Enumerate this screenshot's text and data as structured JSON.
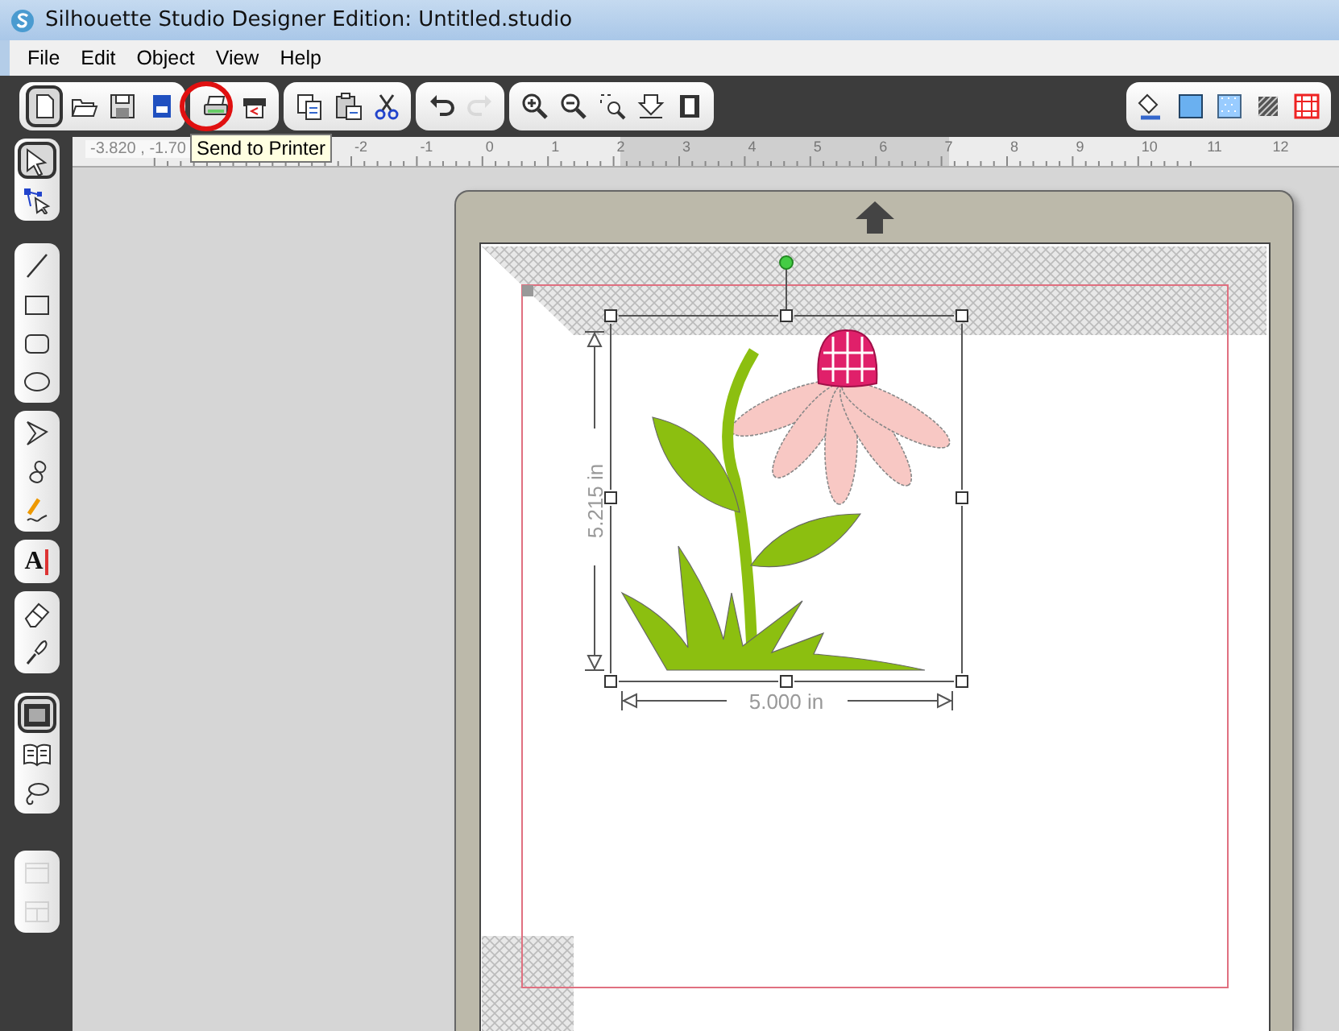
{
  "window": {
    "title": "Silhouette Studio Designer Edition: Untitled.studio"
  },
  "menu": [
    "File",
    "Edit",
    "Object",
    "View",
    "Help"
  ],
  "toolbar": {
    "groups": [
      [
        {
          "kind": "new",
          "selected": true,
          "disabled": false
        },
        {
          "kind": "open",
          "selected": false,
          "disabled": false
        },
        {
          "kind": "save",
          "selected": false,
          "disabled": false
        },
        {
          "kind": "library",
          "selected": false,
          "disabled": false
        }
      ],
      [
        {
          "kind": "print",
          "selected": false,
          "disabled": false
        },
        {
          "kind": "print-cut",
          "selected": false,
          "disabled": false
        }
      ],
      [
        {
          "kind": "copy",
          "selected": false,
          "disabled": false
        },
        {
          "kind": "paste",
          "selected": false,
          "disabled": false
        },
        {
          "kind": "cut",
          "selected": false,
          "disabled": false
        }
      ],
      [
        {
          "kind": "undo",
          "selected": false,
          "disabled": false
        },
        {
          "kind": "redo",
          "selected": false,
          "disabled": true
        }
      ],
      [
        {
          "kind": "zoom-in",
          "selected": false,
          "disabled": false
        },
        {
          "kind": "zoom-out",
          "selected": false,
          "disabled": false
        },
        {
          "kind": "zoom-select",
          "selected": false,
          "disabled": false
        },
        {
          "kind": "zoom-fit",
          "selected": false,
          "disabled": false
        },
        {
          "kind": "fit-page",
          "selected": false,
          "disabled": false
        }
      ]
    ],
    "right_group": [
      {
        "kind": "fill",
        "selected": false,
        "disabled": false
      },
      {
        "kind": "line-color",
        "selected": false,
        "disabled": false
      },
      {
        "kind": "pattern",
        "selected": false,
        "disabled": false
      },
      {
        "kind": "line-style",
        "selected": false,
        "disabled": false
      },
      {
        "kind": "registration",
        "selected": false,
        "disabled": false
      }
    ]
  },
  "tooltip": {
    "text": "Send to Printer"
  },
  "ruler": {
    "readout": "-3.820 , -1.70",
    "ticks": [
      "-2",
      "-1",
      "0",
      "1",
      "2",
      "3",
      "4",
      "5",
      "6",
      "7",
      "8",
      "9",
      "10",
      "11",
      "12"
    ]
  },
  "tools": [
    [
      {
        "kind": "select",
        "selected": true,
        "disabled": false
      },
      {
        "kind": "point-edit",
        "selected": false,
        "disabled": false
      }
    ],
    [
      {
        "kind": "line",
        "selected": false,
        "disabled": false
      },
      {
        "kind": "rectangle",
        "selected": false,
        "disabled": false
      },
      {
        "kind": "rounded-rect",
        "selected": false,
        "disabled": false
      },
      {
        "kind": "ellipse",
        "selected": false,
        "disabled": false
      }
    ],
    [
      {
        "kind": "polygon",
        "selected": false,
        "disabled": false
      },
      {
        "kind": "curve",
        "selected": false,
        "disabled": false
      },
      {
        "kind": "freehand",
        "selected": false,
        "disabled": false
      }
    ],
    [
      {
        "kind": "text",
        "glyph": "A",
        "selected": false,
        "disabled": false
      }
    ],
    [
      {
        "kind": "eraser",
        "selected": false,
        "disabled": false
      },
      {
        "kind": "knife",
        "selected": false,
        "disabled": false
      }
    ],
    [
      {
        "kind": "frame",
        "selected": true,
        "disabled": false
      },
      {
        "kind": "book",
        "selected": false,
        "disabled": false
      },
      {
        "kind": "lasso",
        "selected": false,
        "disabled": false
      }
    ],
    [
      {
        "kind": "panel",
        "selected": false,
        "disabled": true
      },
      {
        "kind": "split-panel",
        "selected": false,
        "disabled": true
      }
    ]
  ],
  "design": {
    "width_label": "5.000 in",
    "height_label": "5.215 in"
  }
}
